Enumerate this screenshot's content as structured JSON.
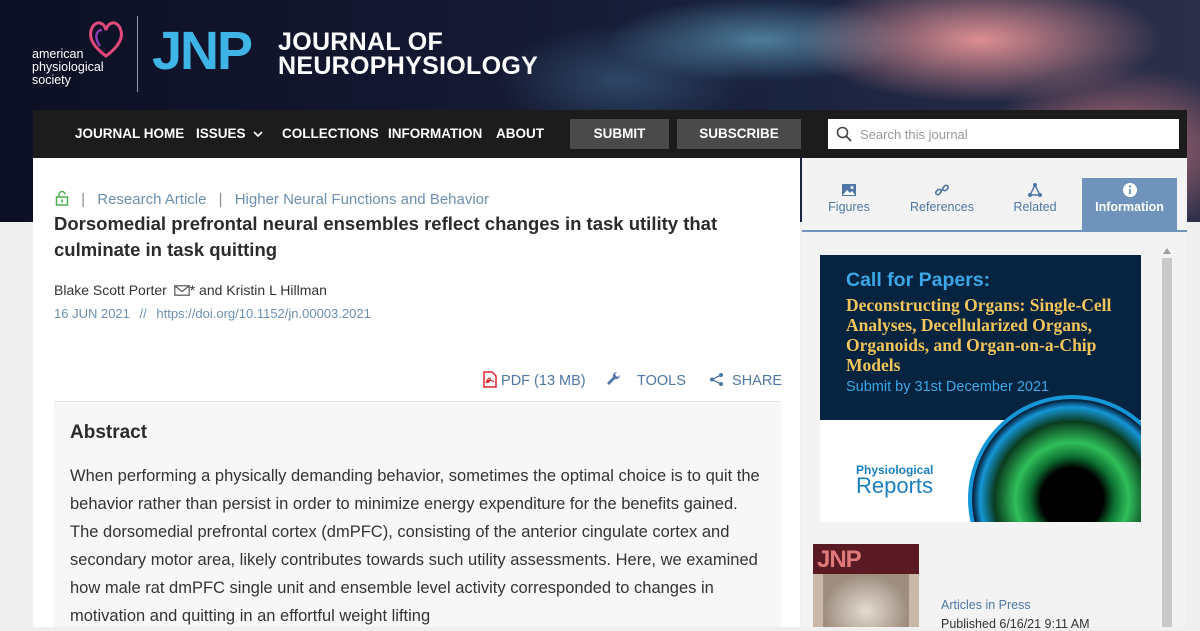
{
  "brand": {
    "society_lines": [
      "american",
      "physiological",
      "society"
    ],
    "journal_abbr": "JNP",
    "journal_name_lines": [
      "JOURNAL OF",
      "NEUROPHYSIOLOGY"
    ]
  },
  "nav": {
    "items": [
      "JOURNAL HOME",
      "ISSUES",
      "COLLECTIONS",
      "INFORMATION",
      "ABOUT"
    ],
    "submit_label": "SUBMIT",
    "subscribe_label": "SUBSCRIBE",
    "search_placeholder": "Search this journal"
  },
  "article": {
    "type": "Research Article",
    "section": "Higher Neural Functions and Behavior",
    "title": "Dorsomedial prefrontal neural ensembles reflect changes in task utility that culminate in task quitting",
    "author1": "Blake Scott Porter",
    "author1_mark": "*",
    "author_rest": " and Kristin L Hillman",
    "date": "16 JUN 2021",
    "date_sep": "//",
    "doi": "https://doi.org/10.1152/jn.00003.2021",
    "pdf_label": "PDF (13 MB)",
    "tools_label": "TOOLS",
    "share_label": "SHARE",
    "abstract_heading": "Abstract",
    "abstract_text": "When performing a physically demanding behavior, sometimes the optimal choice is to quit the behavior rather than persist in order to minimize energy expenditure for the benefits gained. The dorsomedial prefrontal cortex (dmPFC), consisting of the anterior cingulate cortex and secondary motor area, likely contributes towards such utility assessments. Here, we examined how male rat dmPFC single unit and ensemble level activity corresponded to changes in motivation and quitting in an effortful weight lifting"
  },
  "sidebar": {
    "tabs": [
      "Figures",
      "References",
      "Related",
      "Information"
    ],
    "active_tab": "Information",
    "ad": {
      "title": "Call for Papers:",
      "subtitle": "Deconstructing Organs: Single-Cell Analyses, Decellularized Organs, Organoids, and Organ-on-a-Chip Models",
      "deadline": "Submit by 31st December 2021",
      "logo_top": "Physiological",
      "logo_bottom": "Reports"
    },
    "cover_abbr": "JNP",
    "articles_in_press": "Articles in Press",
    "published": "Published 6/16/21 9:11 AM"
  },
  "colors": {
    "accent": "#3fb4e6",
    "link": "#4e77a3",
    "tab_active": "#6f93bb",
    "pdf_red": "#d9262b"
  }
}
